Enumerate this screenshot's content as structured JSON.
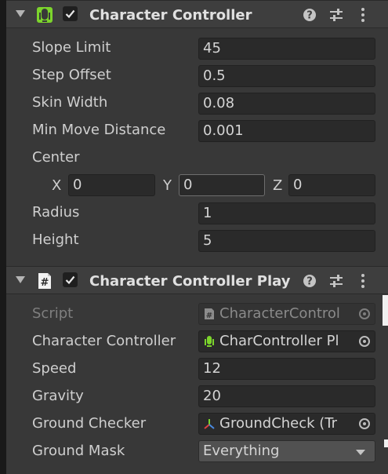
{
  "character_controller": {
    "title": "Character Controller",
    "enabled": true,
    "slope_limit": {
      "label": "Slope Limit",
      "value": "45"
    },
    "step_offset": {
      "label": "Step Offset",
      "value": "0.5"
    },
    "skin_width": {
      "label": "Skin Width",
      "value": "0.08"
    },
    "min_move_distance": {
      "label": "Min Move Distance",
      "value": "0.001"
    },
    "center": {
      "label": "Center",
      "x_label": "X",
      "x": "0",
      "y_label": "Y",
      "y": "0",
      "z_label": "Z",
      "z": "0"
    },
    "radius": {
      "label": "Radius",
      "value": "1"
    },
    "height": {
      "label": "Height",
      "value": "5"
    }
  },
  "character_controller_play": {
    "title": "Character Controller Play",
    "enabled": true,
    "script": {
      "label": "Script",
      "value": "CharacterControl"
    },
    "character_controller": {
      "label": "Character Controller",
      "value": "CharController Pl"
    },
    "speed": {
      "label": "Speed",
      "value": "12"
    },
    "gravity": {
      "label": "Gravity",
      "value": "20"
    },
    "ground_checker": {
      "label": "Ground Checker",
      "value": "GroundCheck (Tr"
    },
    "ground_mask": {
      "label": "Ground Mask",
      "value": "Everything"
    }
  },
  "colors": {
    "background": "#383838",
    "header": "#3e3e3e",
    "field": "#2a2a2a",
    "controller_icon": "#7cd42c",
    "text": "#d2d2d2"
  },
  "icons": [
    "foldout-arrow-icon",
    "character-controller-icon",
    "checkmark-icon",
    "help-icon",
    "presets-icon",
    "more-options-icon",
    "script-icon",
    "object-picker-icon",
    "transform-icon",
    "dropdown-arrow-icon"
  ]
}
